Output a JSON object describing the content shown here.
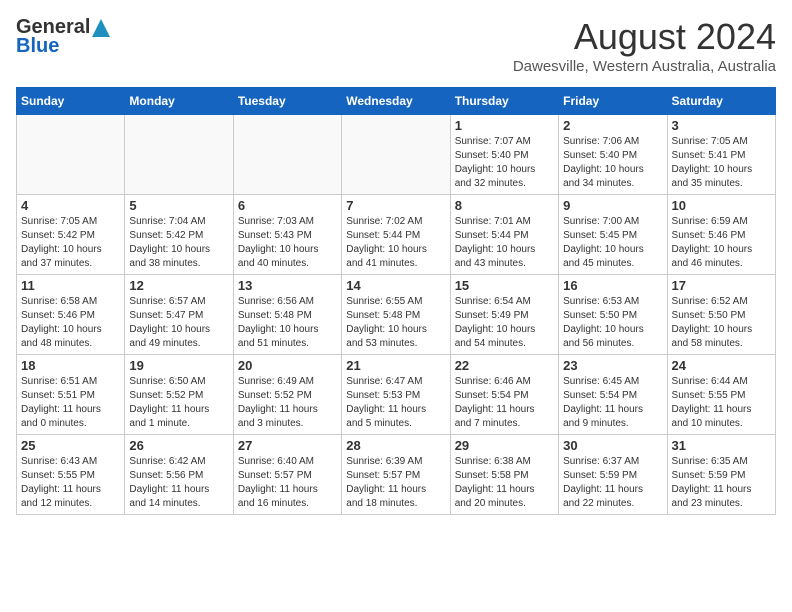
{
  "header": {
    "logo_general": "General",
    "logo_blue": "Blue",
    "month_year": "August 2024",
    "location": "Dawesville, Western Australia, Australia"
  },
  "weekdays": [
    "Sunday",
    "Monday",
    "Tuesday",
    "Wednesday",
    "Thursday",
    "Friday",
    "Saturday"
  ],
  "weeks": [
    [
      {
        "day": "",
        "info": ""
      },
      {
        "day": "",
        "info": ""
      },
      {
        "day": "",
        "info": ""
      },
      {
        "day": "",
        "info": ""
      },
      {
        "day": "1",
        "info": "Sunrise: 7:07 AM\nSunset: 5:40 PM\nDaylight: 10 hours\nand 32 minutes."
      },
      {
        "day": "2",
        "info": "Sunrise: 7:06 AM\nSunset: 5:40 PM\nDaylight: 10 hours\nand 34 minutes."
      },
      {
        "day": "3",
        "info": "Sunrise: 7:05 AM\nSunset: 5:41 PM\nDaylight: 10 hours\nand 35 minutes."
      }
    ],
    [
      {
        "day": "4",
        "info": "Sunrise: 7:05 AM\nSunset: 5:42 PM\nDaylight: 10 hours\nand 37 minutes."
      },
      {
        "day": "5",
        "info": "Sunrise: 7:04 AM\nSunset: 5:42 PM\nDaylight: 10 hours\nand 38 minutes."
      },
      {
        "day": "6",
        "info": "Sunrise: 7:03 AM\nSunset: 5:43 PM\nDaylight: 10 hours\nand 40 minutes."
      },
      {
        "day": "7",
        "info": "Sunrise: 7:02 AM\nSunset: 5:44 PM\nDaylight: 10 hours\nand 41 minutes."
      },
      {
        "day": "8",
        "info": "Sunrise: 7:01 AM\nSunset: 5:44 PM\nDaylight: 10 hours\nand 43 minutes."
      },
      {
        "day": "9",
        "info": "Sunrise: 7:00 AM\nSunset: 5:45 PM\nDaylight: 10 hours\nand 45 minutes."
      },
      {
        "day": "10",
        "info": "Sunrise: 6:59 AM\nSunset: 5:46 PM\nDaylight: 10 hours\nand 46 minutes."
      }
    ],
    [
      {
        "day": "11",
        "info": "Sunrise: 6:58 AM\nSunset: 5:46 PM\nDaylight: 10 hours\nand 48 minutes."
      },
      {
        "day": "12",
        "info": "Sunrise: 6:57 AM\nSunset: 5:47 PM\nDaylight: 10 hours\nand 49 minutes."
      },
      {
        "day": "13",
        "info": "Sunrise: 6:56 AM\nSunset: 5:48 PM\nDaylight: 10 hours\nand 51 minutes."
      },
      {
        "day": "14",
        "info": "Sunrise: 6:55 AM\nSunset: 5:48 PM\nDaylight: 10 hours\nand 53 minutes."
      },
      {
        "day": "15",
        "info": "Sunrise: 6:54 AM\nSunset: 5:49 PM\nDaylight: 10 hours\nand 54 minutes."
      },
      {
        "day": "16",
        "info": "Sunrise: 6:53 AM\nSunset: 5:50 PM\nDaylight: 10 hours\nand 56 minutes."
      },
      {
        "day": "17",
        "info": "Sunrise: 6:52 AM\nSunset: 5:50 PM\nDaylight: 10 hours\nand 58 minutes."
      }
    ],
    [
      {
        "day": "18",
        "info": "Sunrise: 6:51 AM\nSunset: 5:51 PM\nDaylight: 11 hours\nand 0 minutes."
      },
      {
        "day": "19",
        "info": "Sunrise: 6:50 AM\nSunset: 5:52 PM\nDaylight: 11 hours\nand 1 minute."
      },
      {
        "day": "20",
        "info": "Sunrise: 6:49 AM\nSunset: 5:52 PM\nDaylight: 11 hours\nand 3 minutes."
      },
      {
        "day": "21",
        "info": "Sunrise: 6:47 AM\nSunset: 5:53 PM\nDaylight: 11 hours\nand 5 minutes."
      },
      {
        "day": "22",
        "info": "Sunrise: 6:46 AM\nSunset: 5:54 PM\nDaylight: 11 hours\nand 7 minutes."
      },
      {
        "day": "23",
        "info": "Sunrise: 6:45 AM\nSunset: 5:54 PM\nDaylight: 11 hours\nand 9 minutes."
      },
      {
        "day": "24",
        "info": "Sunrise: 6:44 AM\nSunset: 5:55 PM\nDaylight: 11 hours\nand 10 minutes."
      }
    ],
    [
      {
        "day": "25",
        "info": "Sunrise: 6:43 AM\nSunset: 5:55 PM\nDaylight: 11 hours\nand 12 minutes."
      },
      {
        "day": "26",
        "info": "Sunrise: 6:42 AM\nSunset: 5:56 PM\nDaylight: 11 hours\nand 14 minutes."
      },
      {
        "day": "27",
        "info": "Sunrise: 6:40 AM\nSunset: 5:57 PM\nDaylight: 11 hours\nand 16 minutes."
      },
      {
        "day": "28",
        "info": "Sunrise: 6:39 AM\nSunset: 5:57 PM\nDaylight: 11 hours\nand 18 minutes."
      },
      {
        "day": "29",
        "info": "Sunrise: 6:38 AM\nSunset: 5:58 PM\nDaylight: 11 hours\nand 20 minutes."
      },
      {
        "day": "30",
        "info": "Sunrise: 6:37 AM\nSunset: 5:59 PM\nDaylight: 11 hours\nand 22 minutes."
      },
      {
        "day": "31",
        "info": "Sunrise: 6:35 AM\nSunset: 5:59 PM\nDaylight: 11 hours\nand 23 minutes."
      }
    ]
  ]
}
